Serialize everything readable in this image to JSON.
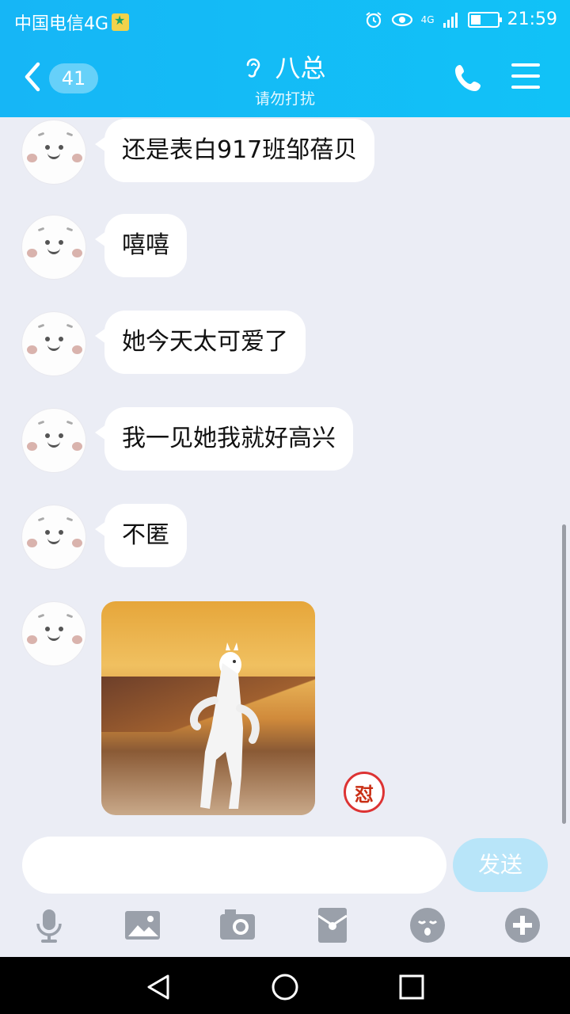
{
  "status_bar": {
    "carrier": "中国电信4G",
    "time": "21:59",
    "network": "4G",
    "icons": [
      "hd-star-icon",
      "alarm-icon",
      "eye-icon",
      "signal-icon",
      "battery-icon"
    ]
  },
  "header": {
    "back_icon": "chevron-left-icon",
    "unread_count": "41",
    "title": "八总",
    "title_icon": "ear-icon",
    "subtitle": "请勿打扰",
    "call_icon": "phone-icon",
    "menu_icon": "menu-icon",
    "accent_color": "#12bdf6"
  },
  "messages": [
    {
      "type": "text",
      "text": "还是表白917班邹蓓贝"
    },
    {
      "type": "text",
      "text": "嘻嘻"
    },
    {
      "type": "text",
      "text": "她今天太可爱了"
    },
    {
      "type": "text",
      "text": "我一见她我就好高兴"
    },
    {
      "type": "text",
      "text": "不匿"
    },
    {
      "type": "sticker",
      "subject": "dancing alpaca",
      "badge_text": "怼"
    }
  ],
  "composer": {
    "input_value": "",
    "send_label": "发送",
    "tools": [
      "microphone-icon",
      "image-icon",
      "camera-icon",
      "red-packet-icon",
      "emoji-icon",
      "plus-icon"
    ]
  },
  "system_nav": [
    "back-triangle-icon",
    "home-circle-icon",
    "recents-square-icon"
  ]
}
